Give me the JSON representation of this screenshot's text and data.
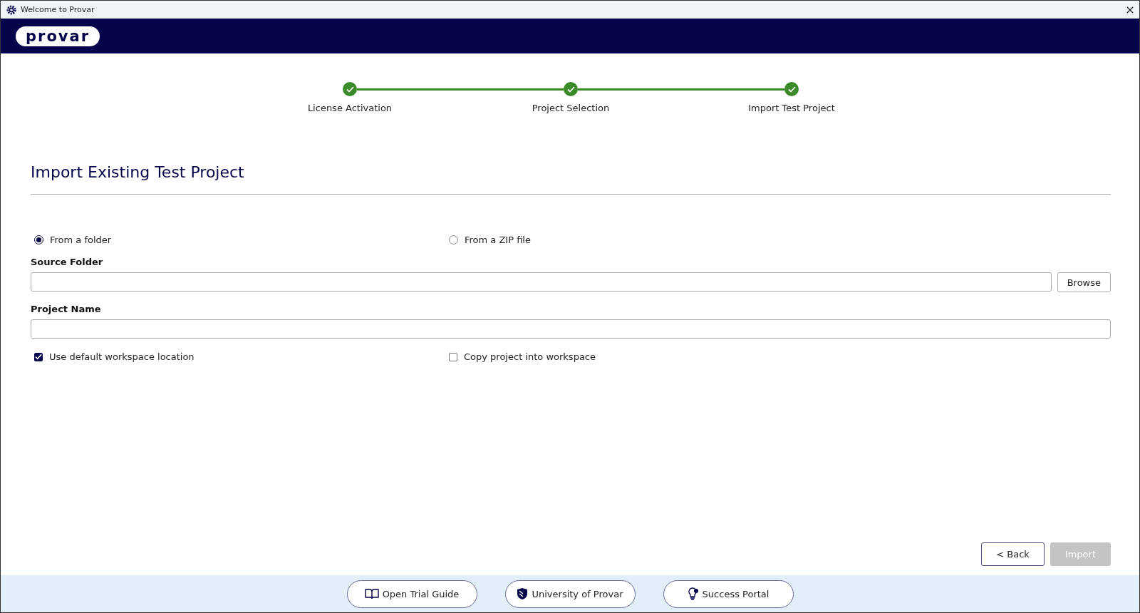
{
  "window": {
    "title": "Welcome to Provar"
  },
  "header": {
    "logo": "provar"
  },
  "steps": [
    {
      "label": "License Activation",
      "done": true
    },
    {
      "label": "Project Selection",
      "done": true
    },
    {
      "label": "Import Test Project",
      "done": true
    }
  ],
  "heading": "Import Existing Test Project",
  "source_options": [
    {
      "label": "From a folder",
      "selected": true
    },
    {
      "label": "From a ZIP file",
      "selected": false
    }
  ],
  "fields": [
    {
      "label": "Source Folder",
      "button": "Browse"
    },
    {
      "label": "Project Name"
    }
  ],
  "options": [
    {
      "label": "Use default workspace location",
      "checked": true
    },
    {
      "label": "Copy project into workspace",
      "checked": false
    }
  ],
  "actions": [
    {
      "label": "< Back",
      "disabled": false
    },
    {
      "label": "Import",
      "disabled": true
    }
  ],
  "footer_links": [
    {
      "kind": "book",
      "label": "Open Trial Guide"
    },
    {
      "kind": "shield",
      "label": "University of Provar"
    },
    {
      "kind": "bulb",
      "label": "Success Portal"
    }
  ]
}
